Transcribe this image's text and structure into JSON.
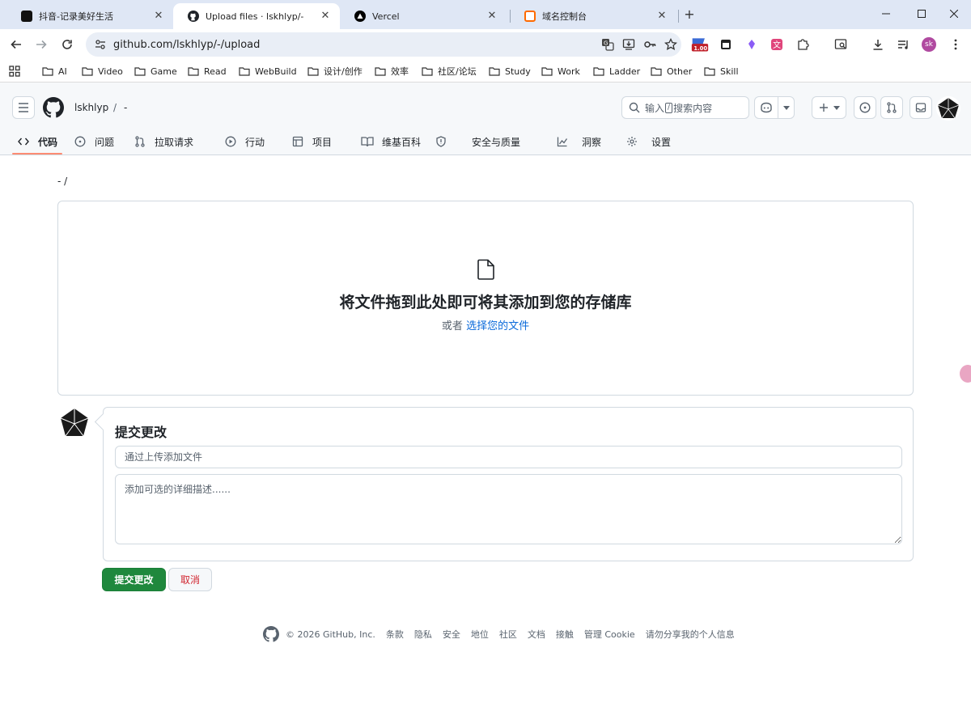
{
  "browser": {
    "tabs": [
      {
        "title": "抖音-记录美好生活",
        "active": false
      },
      {
        "title": "Upload files · lskhlyp/-",
        "active": true
      },
      {
        "title": "Vercel",
        "active": false
      },
      {
        "title": "域名控制台",
        "active": false
      }
    ],
    "url": "github.com/lskhlyp/-/upload",
    "ext_badge": "1.00",
    "profile_initials": "sk",
    "bookmarks": [
      "AI",
      "Video",
      "Game",
      "Read",
      "WebBuild",
      "设计/创作",
      "效率",
      "社区/论坛",
      "Study",
      "Work",
      "Ladder",
      "Other",
      "Skill"
    ]
  },
  "header": {
    "owner": "lskhlyp",
    "separator": "/",
    "repo": "-",
    "search_prefix": "输入",
    "search_key": "/",
    "search_suffix": "搜索内容"
  },
  "repo_nav": {
    "code": "代码",
    "issues": "问题",
    "pulls": "拉取请求",
    "actions": "行动",
    "projects": "项目",
    "wiki": "维基百科",
    "security": "安全与质量",
    "insights": "洞察",
    "settings": "设置"
  },
  "main": {
    "path": "- /",
    "drop_title": "将文件拖到此处即可将其添加到您的存储库",
    "drop_or": "或者",
    "drop_link": "选择您的文件"
  },
  "commit": {
    "title": "提交更改",
    "summary_placeholder": "通过上传添加文件",
    "desc_placeholder": "添加可选的详细描述......",
    "commit_button": "提交更改",
    "cancel_button": "取消"
  },
  "footer": {
    "copyright": "© 2026 GitHub, Inc.",
    "links": [
      "条款",
      "隐私",
      "安全",
      "地位",
      "社区",
      "文档",
      "接触",
      "管理 Cookie",
      "请勿分享我的个人信息"
    ]
  },
  "colors": {
    "primary_button": "#1f883d",
    "link": "#0969da",
    "danger": "#d1242f",
    "tab_underline": "#fd8c73"
  }
}
